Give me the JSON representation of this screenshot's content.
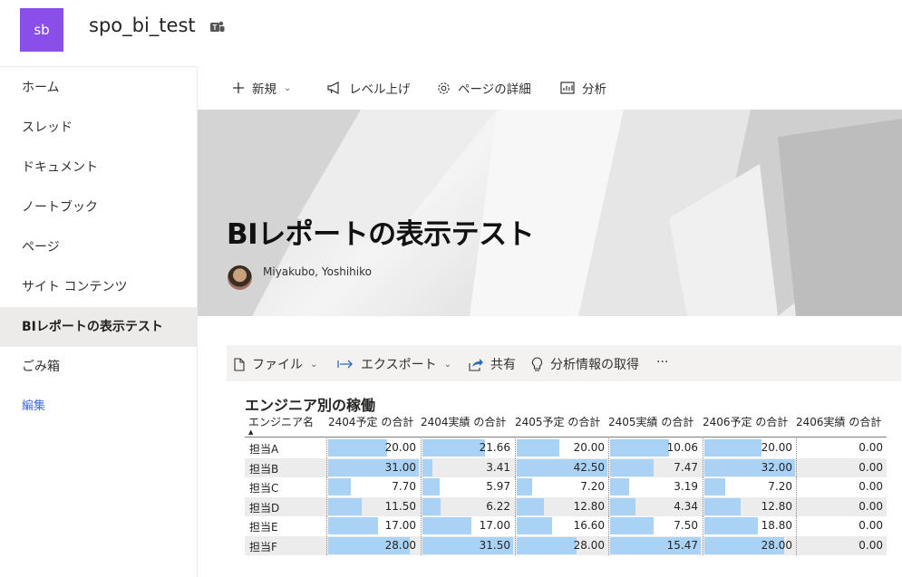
{
  "site": {
    "logo_text": "sb",
    "title": "spo_bi_test",
    "logo_color": "#8a4fe8"
  },
  "nav": {
    "items": [
      {
        "label": "ホーム"
      },
      {
        "label": "スレッド"
      },
      {
        "label": "ドキュメント"
      },
      {
        "label": "ノートブック"
      },
      {
        "label": "ページ"
      },
      {
        "label": "サイト コンテンツ"
      },
      {
        "label": "BIレポートの表示テスト",
        "selected": true
      },
      {
        "label": "ごみ箱"
      }
    ],
    "edit_label": "編集"
  },
  "command_bar": {
    "new_label": "新規",
    "promote_label": "レベル上げ",
    "details_label": "ページの詳細",
    "analytics_label": "分析"
  },
  "page": {
    "title": "BIレポートの表示テスト",
    "author": "Miyakubo, Yoshihiko"
  },
  "powerbi_bar": {
    "file_label": "ファイル",
    "export_label": "エクスポート",
    "share_label": "共有",
    "insights_label": "分析情報の取得",
    "more_label": "···"
  },
  "report": {
    "title": "エンジニア別の稼働",
    "bar_color": "#a9d2f5",
    "columns": [
      "エンジニア名",
      "2404予定 の合計",
      "2404実績 の合計",
      "2405予定 の合計",
      "2405実績 の合計",
      "2406予定 の合計",
      "2406実績 の合計"
    ],
    "rows": [
      {
        "name": "担当A",
        "values": [
          "20.00",
          "21.66",
          "20.00",
          "10.06",
          "20.00",
          "0.00"
        ]
      },
      {
        "name": "担当B",
        "values": [
          "31.00",
          "3.41",
          "42.50",
          "7.47",
          "32.00",
          "0.00"
        ]
      },
      {
        "name": "担当C",
        "values": [
          "7.70",
          "5.97",
          "7.20",
          "3.19",
          "7.20",
          "0.00"
        ]
      },
      {
        "name": "担当D",
        "values": [
          "11.50",
          "6.22",
          "12.80",
          "4.34",
          "12.80",
          "0.00"
        ]
      },
      {
        "name": "担当E",
        "values": [
          "17.00",
          "17.00",
          "16.60",
          "7.50",
          "18.80",
          "0.00"
        ]
      },
      {
        "name": "担当F",
        "values": [
          "28.00",
          "31.50",
          "28.00",
          "15.47",
          "28.00",
          "0.00"
        ]
      }
    ]
  }
}
